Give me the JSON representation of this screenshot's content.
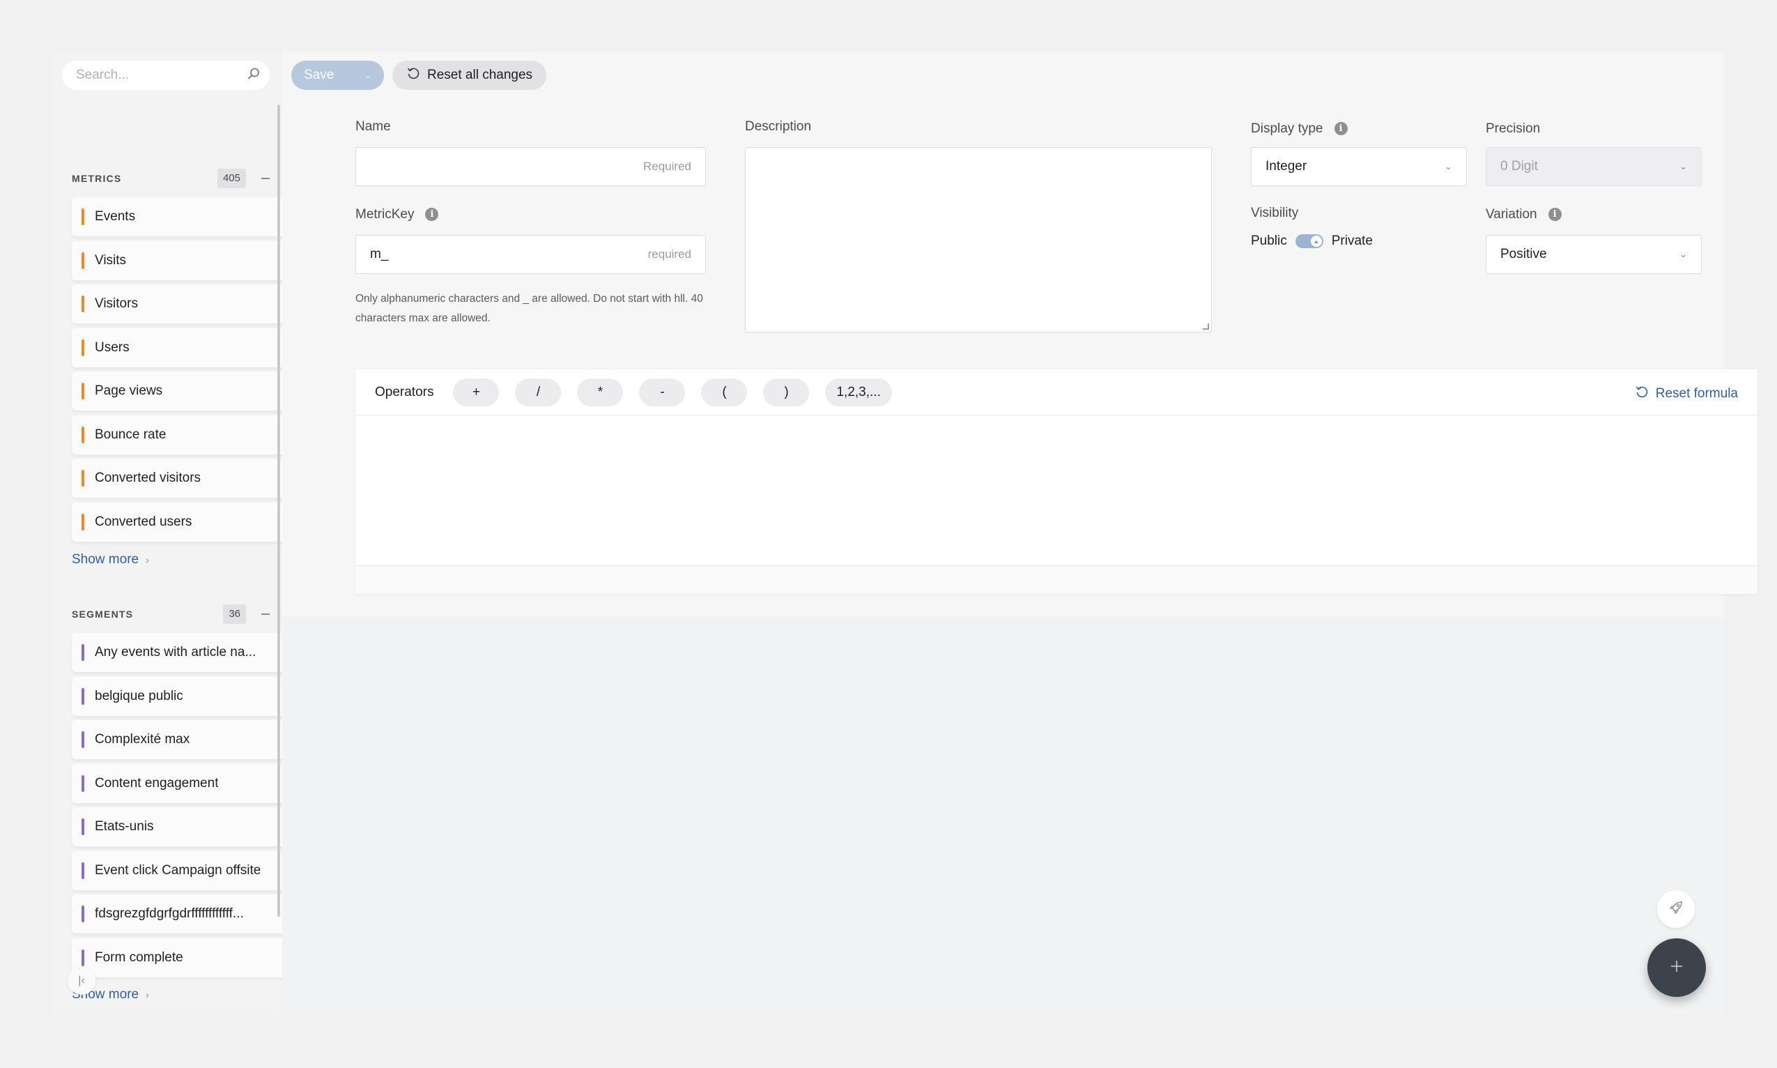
{
  "sidebar": {
    "search_placeholder": "Search...",
    "metrics": {
      "title": "METRICS",
      "count": "405",
      "items": [
        {
          "label": "Events"
        },
        {
          "label": "Visits"
        },
        {
          "label": "Visitors"
        },
        {
          "label": "Users"
        },
        {
          "label": "Page views"
        },
        {
          "label": "Bounce rate"
        },
        {
          "label": "Converted visitors"
        },
        {
          "label": "Converted users"
        }
      ],
      "show_more": "Show more"
    },
    "segments": {
      "title": "SEGMENTS",
      "count": "36",
      "items": [
        {
          "label": "Any events with article na..."
        },
        {
          "label": "belgique public"
        },
        {
          "label": "Complexité max"
        },
        {
          "label": "Content engagement"
        },
        {
          "label": "Etats-unis"
        },
        {
          "label": "Event click Campaign offsite"
        },
        {
          "label": "fdsgrezgfdgrfgdrffffffffffff..."
        },
        {
          "label": "Form complete"
        }
      ],
      "show_more": "Show more"
    }
  },
  "toolbar": {
    "save_label": "Save",
    "reset_all_label": "Reset all changes"
  },
  "form": {
    "name": {
      "label": "Name",
      "value": "",
      "hint": "Required"
    },
    "metric_key": {
      "label": "MetricKey",
      "value": "m_",
      "hint": "required",
      "help": "Only alphanumeric characters and _ are allowed. Do not start with hll. 40 characters max are allowed."
    },
    "description": {
      "label": "Description",
      "value": ""
    },
    "display_type": {
      "label": "Display type",
      "value": "Integer"
    },
    "precision": {
      "label": "Precision",
      "value": "0 Digit"
    },
    "visibility": {
      "label": "Visibility",
      "left": "Public",
      "right": "Private"
    },
    "variation": {
      "label": "Variation",
      "value": "Positive"
    }
  },
  "formula": {
    "operators_label": "Operators",
    "operators": [
      "+",
      "/",
      "*",
      "-",
      "(",
      ")",
      "1,2,3,..."
    ],
    "reset_label": "Reset formula"
  },
  "colors": {
    "metric_bar": "#f08a24",
    "segment_bar": "#8a6bd6",
    "link": "#2f5da8",
    "save_button": "#b7c8de",
    "fab": "#3d434c"
  }
}
